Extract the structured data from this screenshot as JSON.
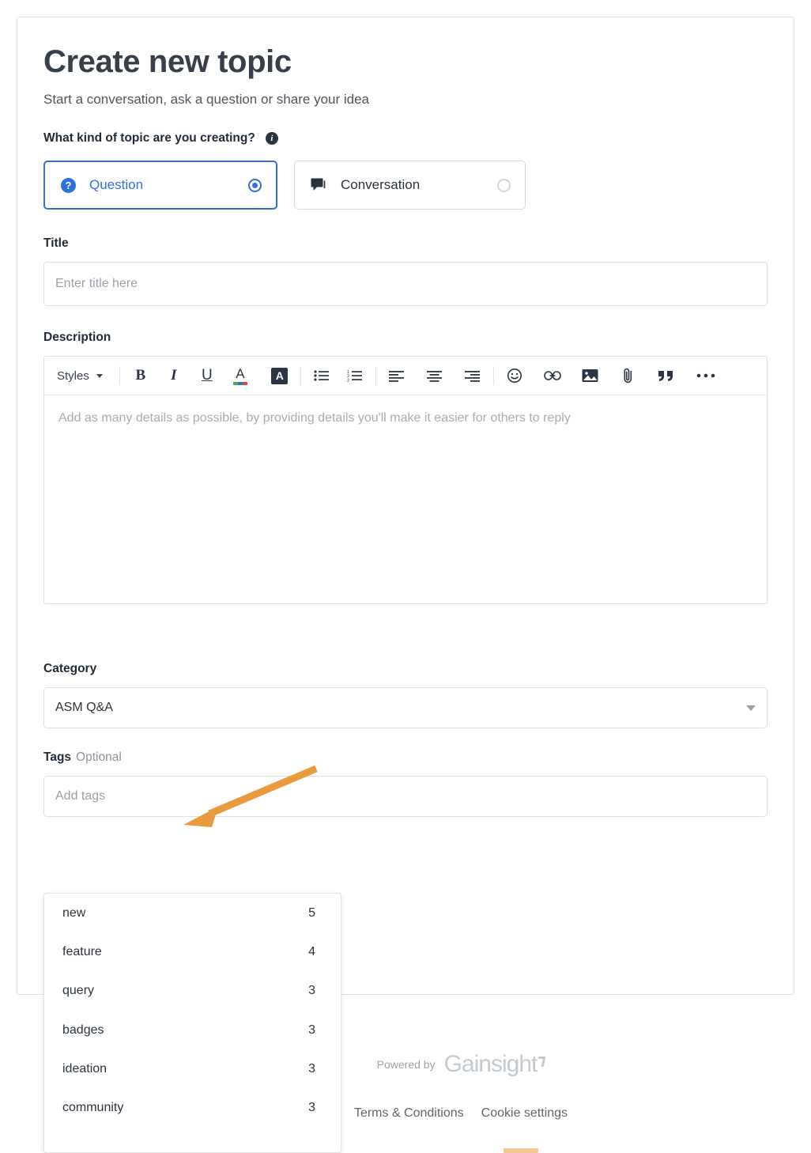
{
  "page": {
    "title": "Create new topic",
    "subtitle": "Start a conversation, ask a question or share your idea"
  },
  "topic_type": {
    "label": "What kind of topic are you creating?",
    "info_icon": "info-icon",
    "info_glyph": "i",
    "options": [
      {
        "label": "Question",
        "icon": "question-circle-icon",
        "icon_glyph": "?",
        "selected": true
      },
      {
        "label": "Conversation",
        "icon": "comment-icon",
        "selected": false
      }
    ]
  },
  "title_field": {
    "label": "Title",
    "placeholder": "Enter title here",
    "value": ""
  },
  "description_field": {
    "label": "Description",
    "placeholder": "Add as many details as possible, by providing details you'll make it easier for others to reply",
    "value": "",
    "toolbar": {
      "styles_label": "Styles",
      "buttons": [
        {
          "name": "bold-icon",
          "glyph": "B"
        },
        {
          "name": "italic-icon",
          "glyph": "I"
        },
        {
          "name": "underline-icon",
          "glyph": "U"
        },
        {
          "name": "text-color-icon",
          "glyph": "A"
        },
        {
          "name": "background-color-icon",
          "glyph": "A"
        },
        {
          "name": "bulleted-list-icon",
          "glyph": ""
        },
        {
          "name": "numbered-list-icon",
          "glyph": ""
        },
        {
          "name": "align-left-icon",
          "glyph": ""
        },
        {
          "name": "align-center-icon",
          "glyph": ""
        },
        {
          "name": "align-right-icon",
          "glyph": ""
        },
        {
          "name": "emoji-icon",
          "glyph": ""
        },
        {
          "name": "link-icon",
          "glyph": ""
        },
        {
          "name": "image-icon",
          "glyph": ""
        },
        {
          "name": "attachment-icon",
          "glyph": ""
        },
        {
          "name": "blockquote-icon",
          "glyph": ""
        },
        {
          "name": "more-options-icon",
          "glyph": ""
        }
      ]
    }
  },
  "category_field": {
    "label": "Category",
    "value": "ASM Q&A",
    "chevron_icon": "chevron-down-icon"
  },
  "tags_field": {
    "label": "Tags",
    "optional_label": "Optional",
    "placeholder": "Add tags",
    "value": "",
    "suggestions": [
      {
        "name": "new",
        "count": "5"
      },
      {
        "name": "feature",
        "count": "4"
      },
      {
        "name": "query",
        "count": "3"
      },
      {
        "name": "badges",
        "count": "3"
      },
      {
        "name": "ideation",
        "count": "3"
      },
      {
        "name": "community",
        "count": "3"
      }
    ]
  },
  "footer": {
    "powered_by": "Powered by",
    "brand": "Gainsight",
    "links": [
      {
        "label": "Terms & Conditions"
      },
      {
        "label": "Cookie settings"
      }
    ]
  },
  "annotation": {
    "arrow_color": "#e89a3c",
    "points_to": "tags-label"
  },
  "colors": {
    "accent_blue": "#2f6fe0",
    "text_dark": "#2b333d",
    "border": "#dcdfe3",
    "annotation_orange": "#e89a3c"
  }
}
